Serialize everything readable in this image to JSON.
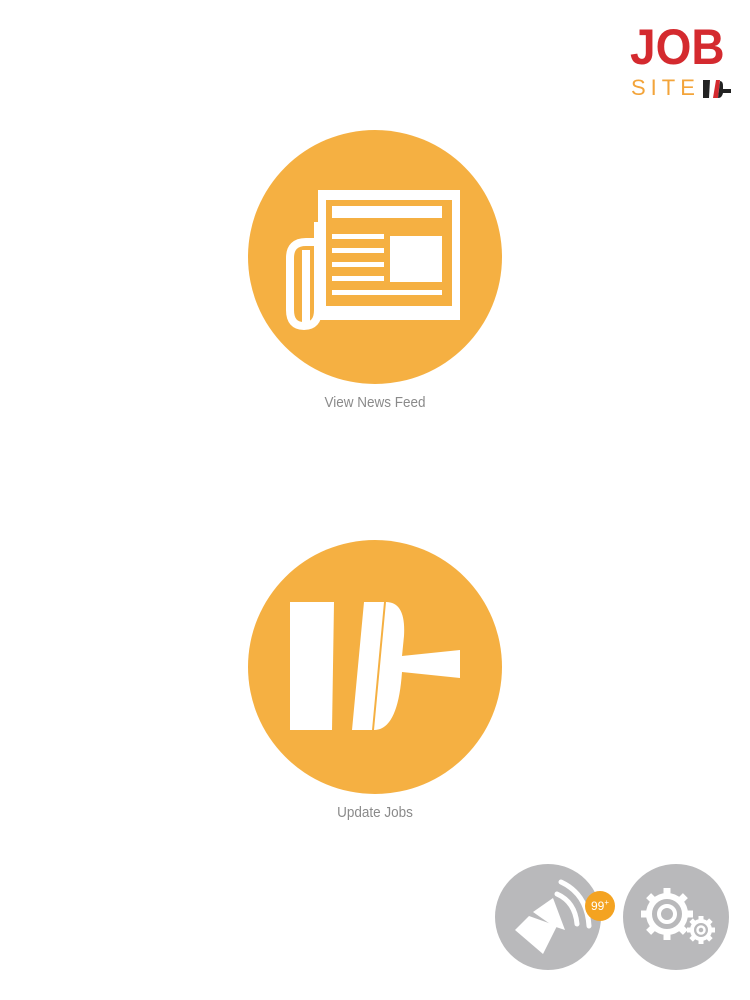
{
  "colors": {
    "brand_red": "#d42a2f",
    "brand_orange": "#f3a43a",
    "accent_orange": "#f5b042",
    "control_gray": "#b9b9bb",
    "label_gray": "#8a8a8a",
    "logo_dark": "#222222",
    "badge_orange": "#f4a321"
  },
  "logo": {
    "job_text": "JOB",
    "site_text": "SITE",
    "mark_icon": "jobsite-mark-icon"
  },
  "actions": {
    "news_feed": {
      "label": "View News Feed",
      "icon": "newspaper-icon"
    },
    "update_jobs": {
      "label": "Update Jobs",
      "icon": "jobsite-mark-icon"
    }
  },
  "controls": {
    "announcements": {
      "icon": "megaphone-icon",
      "badge_count": "99",
      "badge_suffix": "+"
    },
    "settings": {
      "icon": "gears-icon"
    }
  }
}
